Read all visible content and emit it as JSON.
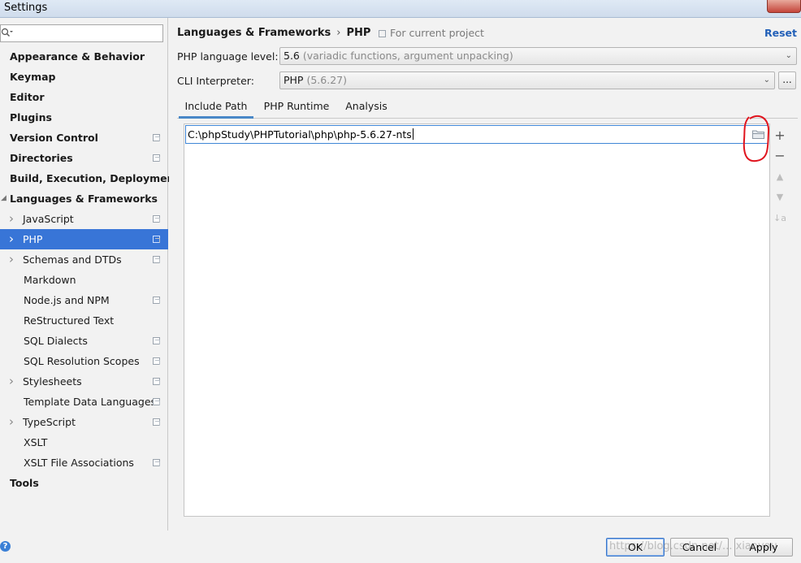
{
  "window": {
    "title": "Settings"
  },
  "search": {
    "value": "",
    "icon": "search-icon"
  },
  "sidebar": {
    "items": [
      {
        "label": "Appearance & Behavior",
        "level": "top",
        "arrow": "right",
        "project": false
      },
      {
        "label": "Keymap",
        "level": "top",
        "arrow": "none",
        "project": false
      },
      {
        "label": "Editor",
        "level": "top",
        "arrow": "right",
        "project": false
      },
      {
        "label": "Plugins",
        "level": "top",
        "arrow": "none",
        "project": false
      },
      {
        "label": "Version Control",
        "level": "top",
        "arrow": "right",
        "project": true
      },
      {
        "label": "Directories",
        "level": "top",
        "arrow": "none",
        "project": true
      },
      {
        "label": "Build, Execution, Deployment",
        "level": "top",
        "arrow": "right",
        "project": false
      },
      {
        "label": "Languages & Frameworks",
        "level": "top",
        "arrow": "down",
        "project": false
      },
      {
        "label": "JavaScript",
        "level": "child",
        "arrow": "right",
        "project": true
      },
      {
        "label": "PHP",
        "level": "child",
        "arrow": "right",
        "project": true,
        "selected": true
      },
      {
        "label": "Schemas and DTDs",
        "level": "child",
        "arrow": "right",
        "project": true
      },
      {
        "label": "Markdown",
        "level": "leaf",
        "arrow": "none",
        "project": false
      },
      {
        "label": "Node.js and NPM",
        "level": "leaf",
        "arrow": "none",
        "project": true
      },
      {
        "label": "ReStructured Text",
        "level": "leaf",
        "arrow": "none",
        "project": false
      },
      {
        "label": "SQL Dialects",
        "level": "leaf",
        "arrow": "none",
        "project": true
      },
      {
        "label": "SQL Resolution Scopes",
        "level": "leaf",
        "arrow": "none",
        "project": true
      },
      {
        "label": "Stylesheets",
        "level": "child",
        "arrow": "right",
        "project": true
      },
      {
        "label": "Template Data Languages",
        "level": "leaf",
        "arrow": "none",
        "project": true
      },
      {
        "label": "TypeScript",
        "level": "child",
        "arrow": "right",
        "project": true
      },
      {
        "label": "XSLT",
        "level": "leaf",
        "arrow": "none",
        "project": false
      },
      {
        "label": "XSLT File Associations",
        "level": "leaf",
        "arrow": "none",
        "project": true
      },
      {
        "label": "Tools",
        "level": "top",
        "arrow": "right",
        "project": false
      }
    ]
  },
  "header": {
    "breadcrumb_parent": "Languages & Frameworks",
    "breadcrumb_sep": "›",
    "breadcrumb_current": "PHP",
    "scope": "For current project",
    "reset": "Reset"
  },
  "php_level": {
    "label": "PHP language level:",
    "value": "5.6",
    "detail": "(variadic functions, argument unpacking)"
  },
  "cli": {
    "label": "CLI Interpreter:",
    "value": "PHP",
    "detail": "(5.6.27)",
    "more_button": "..."
  },
  "tabs": [
    {
      "label": "Include Path",
      "active": true
    },
    {
      "label": "PHP Runtime",
      "active": false
    },
    {
      "label": "Analysis",
      "active": false
    }
  ],
  "include_path": {
    "entries": [
      "C:\\phpStudy\\PHPTutorial\\php\\php-5.6.27-nts"
    ],
    "browse_icon": "folder-icon"
  },
  "toolbar": {
    "add": "+",
    "remove": "−",
    "move_up": "▲",
    "move_down": "▼",
    "sort": "↓a"
  },
  "footer": {
    "help": "?",
    "ok": "OK",
    "cancel": "Cancel",
    "apply": "Apply",
    "watermark": "https://blog.csdn.net/... xiaoyou"
  },
  "colors": {
    "selection": "#3875d7",
    "link": "#2260b8",
    "annotation": "#e0141e"
  }
}
